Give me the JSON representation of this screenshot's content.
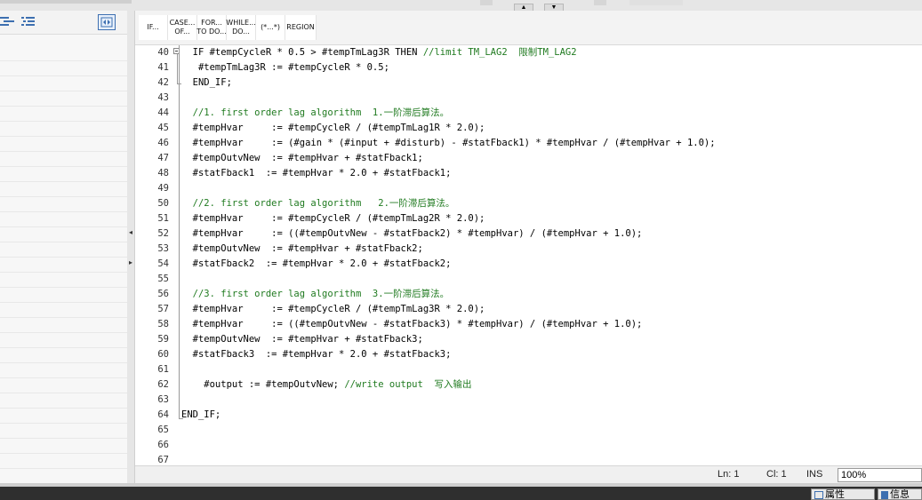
{
  "snippets": [
    {
      "label": "IF..."
    },
    {
      "label": "CASE...\nOF..."
    },
    {
      "label": "FOR...\nTO DO..."
    },
    {
      "label": "WHILE...\nDO..."
    },
    {
      "label": "(*...*)"
    },
    {
      "label": "REGION"
    }
  ],
  "code_lines": [
    {
      "num": "40",
      "text": "  IF #tempCycleR * 0.5 > #tempTmLag3R THEN //limit TM_LAG2  限制TM_LAG2",
      "comment": false
    },
    {
      "num": "41",
      "text": "   #tempTmLag3R := #tempCycleR * 0.5;",
      "comment": false
    },
    {
      "num": "42",
      "text": "  END_IF;",
      "comment": false
    },
    {
      "num": "43",
      "text": "",
      "comment": false
    },
    {
      "num": "44",
      "text": "  //1. first order lag algorithm  1.一阶滞后算法。",
      "comment": true
    },
    {
      "num": "45",
      "text": "  #tempHvar     := #tempCycleR / (#tempTmLag1R * 2.0);",
      "comment": false
    },
    {
      "num": "46",
      "text": "  #tempHvar     := (#gain * (#input + #disturb) - #statFback1) * #tempHvar / (#tempHvar + 1.0);",
      "comment": false
    },
    {
      "num": "47",
      "text": "  #tempOutvNew  := #tempHvar + #statFback1;",
      "comment": false
    },
    {
      "num": "48",
      "text": "  #statFback1  := #tempHvar * 2.0 + #statFback1;",
      "comment": false
    },
    {
      "num": "49",
      "text": "",
      "comment": false
    },
    {
      "num": "50",
      "text": "  //2. first order lag algorithm   2.一阶滞后算法。",
      "comment": true
    },
    {
      "num": "51",
      "text": "  #tempHvar     := #tempCycleR / (#tempTmLag2R * 2.0);",
      "comment": false
    },
    {
      "num": "52",
      "text": "  #tempHvar     := ((#tempOutvNew - #statFback2) * #tempHvar) / (#tempHvar + 1.0);",
      "comment": false
    },
    {
      "num": "53",
      "text": "  #tempOutvNew  := #tempHvar + #statFback2;",
      "comment": false
    },
    {
      "num": "54",
      "text": "  #statFback2  := #tempHvar * 2.0 + #statFback2;",
      "comment": false
    },
    {
      "num": "55",
      "text": "",
      "comment": false
    },
    {
      "num": "56",
      "text": "  //3. first order lag algorithm  3.一阶滞后算法。",
      "comment": true
    },
    {
      "num": "57",
      "text": "  #tempHvar     := #tempCycleR / (#tempTmLag3R * 2.0);",
      "comment": false
    },
    {
      "num": "58",
      "text": "  #tempHvar     := ((#tempOutvNew - #statFback3) * #tempHvar) / (#tempHvar + 1.0);",
      "comment": false
    },
    {
      "num": "59",
      "text": "  #tempOutvNew  := #tempHvar + #statFback3;",
      "comment": false
    },
    {
      "num": "60",
      "text": "  #statFback3  := #tempHvar * 2.0 + #statFback3;",
      "comment": false
    },
    {
      "num": "61",
      "text": "",
      "comment": false
    },
    {
      "num": "62",
      "text": "    #output := #tempOutvNew; //write output  写入输出",
      "comment": false
    },
    {
      "num": "63",
      "text": "",
      "comment": false
    },
    {
      "num": "64",
      "text": "END_IF;",
      "comment": false
    },
    {
      "num": "65",
      "text": "",
      "comment": false
    },
    {
      "num": "66",
      "text": "",
      "comment": false
    },
    {
      "num": "67",
      "text": "",
      "comment": false
    }
  ],
  "status": {
    "ln": "Ln: 1",
    "cl": "Cl: 1",
    "mode": "INS",
    "zoom": "100%"
  },
  "bottom_tabs": [
    {
      "label": "属性"
    },
    {
      "label": "信息"
    }
  ],
  "colors": {
    "comment": "#1f7a1f",
    "accent": "#3d6fb0"
  }
}
